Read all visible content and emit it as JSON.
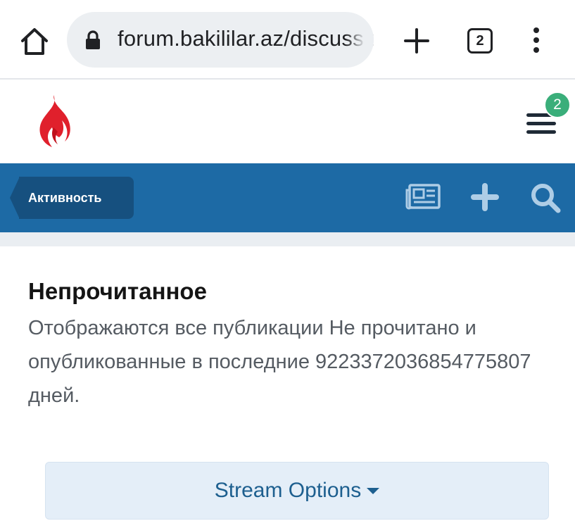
{
  "browser": {
    "url": "forum.bakililar.az/discussions",
    "tab_count": "2"
  },
  "header": {
    "notification_count": "2"
  },
  "nav": {
    "breadcrumb_label": "Активность"
  },
  "main": {
    "title": "Непрочитанное",
    "description": "Отображаются все публикации Не прочитано и опубликованные в последние 9223372036854775807 дней.",
    "stream_options_label": "Stream Options"
  },
  "colors": {
    "nav_blue": "#1d6aa5",
    "crumb_blue": "#16507f",
    "badge_green": "#3aae7a",
    "logo_red": "#e0202c"
  }
}
